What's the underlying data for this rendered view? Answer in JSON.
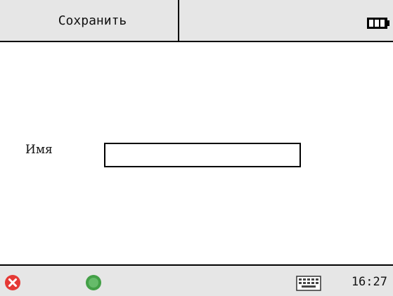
{
  "header": {
    "save_label": "Сохранить",
    "battery_icon": "battery-full-icon"
  },
  "form": {
    "name_label": "Имя",
    "name_value": "",
    "name_placeholder": ""
  },
  "taskbar": {
    "close_icon": "close-icon",
    "ok_icon": "ok-icon",
    "keyboard_icon": "keyboard-icon",
    "time": "16:27"
  },
  "colors": {
    "bar_background": "#e6e6e6",
    "close_red": "#e53935",
    "ok_green": "#43a047"
  }
}
